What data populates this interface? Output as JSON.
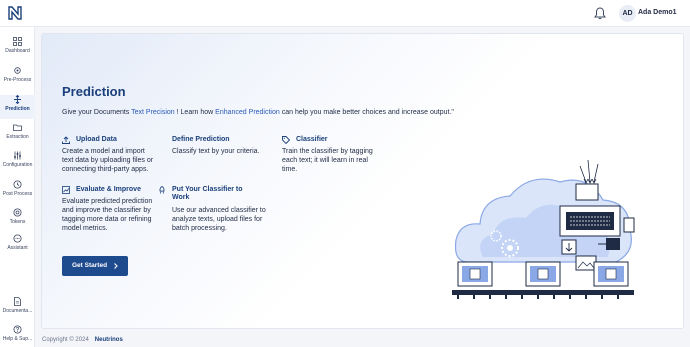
{
  "header": {
    "user_initials": "AD",
    "user_name": "Ada Demo1",
    "icons": [
      "logo-icon",
      "bell-icon"
    ]
  },
  "sidebar": {
    "items": [
      {
        "label": "Dashboard",
        "icon": "grid-icon"
      },
      {
        "label": "Pre-Process",
        "icon": "gear-icon"
      },
      {
        "label": "Prediction",
        "icon": "arrows-icon",
        "active": true
      },
      {
        "label": "Extraction",
        "icon": "folder-icon"
      },
      {
        "label": "Configuration",
        "icon": "sliders-icon"
      },
      {
        "label": "Post Process",
        "icon": "clock-icon"
      },
      {
        "label": "Tokens",
        "icon": "coin-icon"
      },
      {
        "label": "Assistant",
        "icon": "chat-icon"
      },
      {
        "label": "Documenta...",
        "icon": "document-icon"
      },
      {
        "label": "Help & Sup...",
        "icon": "help-icon"
      }
    ]
  },
  "main": {
    "title": "Prediction",
    "intro": {
      "part1": "Give your Documents ",
      "highlight1": "Text Precision",
      "part2": " ! Learn how ",
      "highlight2": "Enhanced Prediction",
      "part3": " can help you make better choices and increase output.\""
    },
    "features": [
      {
        "title": "Upload Data",
        "desc_lines": [
          "Create a model and import",
          "text data by uploading files or",
          "connecting third-party apps."
        ],
        "icon": "upload-icon"
      },
      {
        "title": "Define Prediction",
        "desc_lines": [
          "Classify text by your criteria."
        ],
        "icon": "none"
      },
      {
        "title": "Classifier",
        "desc_lines": [
          "Train the classifier by tagging",
          "each text; it will learn in real",
          "time."
        ],
        "icon": "tag-icon"
      },
      {
        "title": "Evaluate & Improve",
        "desc_lines": [
          "Evaluate predicted prediction",
          "and improve the classifier by",
          "tagging more data or refining",
          "model metrics."
        ],
        "icon": "chart-icon"
      },
      {
        "title_lines": [
          "Put Your Classifier to",
          "Work"
        ],
        "desc_lines": [
          "Use our advanced classifier to",
          "analyze texts, upload files for",
          "batch processing."
        ],
        "icon": "rocket-icon"
      }
    ],
    "cta_label": "Get Started"
  },
  "footer": {
    "copyright": "Copyright © 2024",
    "brand": "Neutrinos"
  },
  "colors": {
    "accent": "#1e4a8e",
    "title": "#1a3f7a",
    "highlight": "#2a5ab8",
    "illustration": "#8aa8e6"
  }
}
